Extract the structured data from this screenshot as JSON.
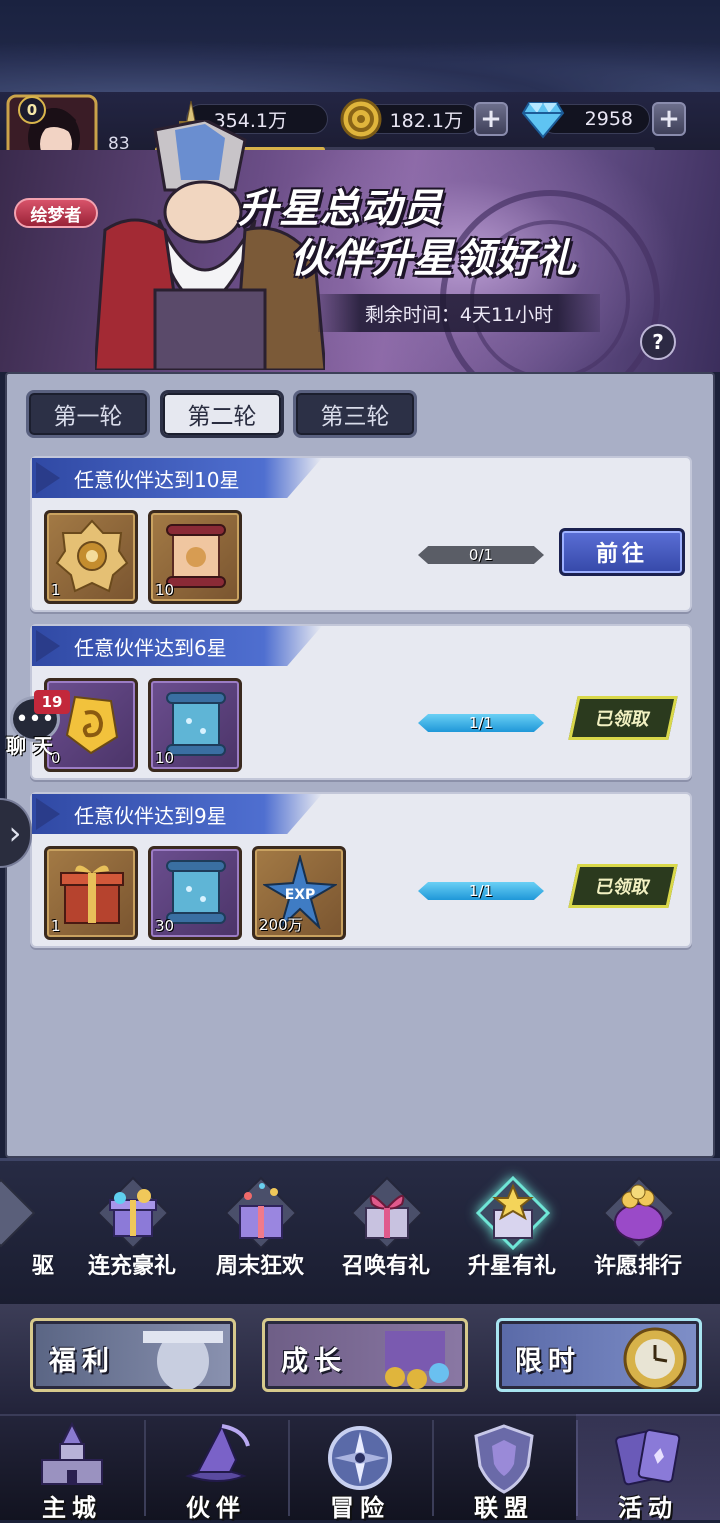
{
  "player": {
    "level_badge": "0",
    "level": "83",
    "vip_title": "绘梦者",
    "exp_fraction": 0.34
  },
  "resources": {
    "power": "354.1万",
    "gold": "182.1万",
    "diamonds": "2958"
  },
  "banner": {
    "title_line1": "升星总动员",
    "title_line2": "伙伴升星领好礼",
    "timer": "剩余时间：4天11小时",
    "help": "?"
  },
  "round_tabs": [
    "第一轮",
    "第二轮",
    "第三轮"
  ],
  "active_round": 1,
  "tasks": [
    {
      "title": "任意伙伴达到10星",
      "rewards": [
        {
          "icon": "medal-icon",
          "count": "1"
        },
        {
          "icon": "scroll-icon",
          "count": "10"
        }
      ],
      "progress": "0/1",
      "action": "前往"
    },
    {
      "title": "任意伙伴达到6星",
      "rewards": [
        {
          "icon": "gold-rune-icon",
          "count": "0"
        },
        {
          "icon": "blue-scroll-icon",
          "count": "10"
        }
      ],
      "progress": "1/1",
      "action": "已领取"
    },
    {
      "title": "任意伙伴达到9星",
      "rewards": [
        {
          "icon": "gift-box-icon",
          "count": "1"
        },
        {
          "icon": "blue-scroll-icon",
          "count": "30"
        },
        {
          "icon": "exp-star-icon",
          "count": "200万"
        }
      ],
      "progress": "1/1",
      "action": "已领取"
    }
  ],
  "chat": {
    "badge": "19",
    "label": "聊 天"
  },
  "events": [
    "驱",
    "连充豪礼",
    "周末狂欢",
    "召唤有礼",
    "升星有礼",
    "许愿排行"
  ],
  "categories": [
    "福利",
    "成长",
    "限时"
  ],
  "nav": [
    "主城",
    "伙伴",
    "冒险",
    "联盟",
    "活动"
  ],
  "colors": {
    "panel_bg": "#a9afc6",
    "task_header": "#3f5bc0",
    "progress_full": "#2aa6e4",
    "progress_empty": "#5a5d66",
    "claimed_border": "#d9d84a"
  }
}
